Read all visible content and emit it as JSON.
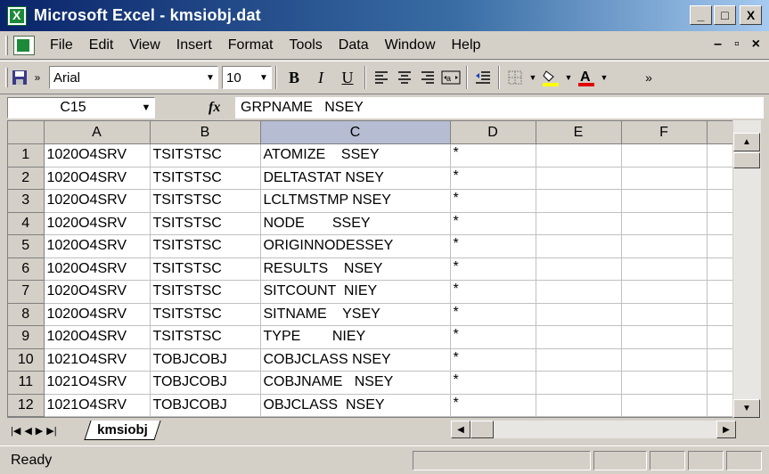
{
  "window": {
    "title": "Microsoft Excel - kmsiobj.dat",
    "minimize": "_",
    "maximize": "□",
    "close": "X"
  },
  "menu": {
    "items": [
      "File",
      "Edit",
      "View",
      "Insert",
      "Format",
      "Tools",
      "Data",
      "Window",
      "Help"
    ],
    "doc_min": "–",
    "doc_restore": "▫",
    "doc_close": "×"
  },
  "toolbar": {
    "font_name": "Arial",
    "font_size": "10",
    "bold": "B",
    "italic": "I",
    "underline": "U",
    "font_color": "#e00000",
    "fill_color": "#ffff00"
  },
  "formula_bar": {
    "name_box": "C15",
    "fx": "fx",
    "content": "GRPNAME   NSEY"
  },
  "grid": {
    "columns": [
      "A",
      "B",
      "C",
      "D",
      "E",
      "F"
    ],
    "selected_column": "C",
    "rows": [
      {
        "n": "1",
        "a": "1020O4SRV",
        "b": "TSITSTSC",
        "c": "ATOMIZE    SSEY",
        "d": "*"
      },
      {
        "n": "2",
        "a": "1020O4SRV",
        "b": "TSITSTSC",
        "c": "DELTASTAT NSEY",
        "d": "*"
      },
      {
        "n": "3",
        "a": "1020O4SRV",
        "b": "TSITSTSC",
        "c": "LCLTMSTMP NSEY",
        "d": "*"
      },
      {
        "n": "4",
        "a": "1020O4SRV",
        "b": "TSITSTSC",
        "c": "NODE       SSEY",
        "d": "*"
      },
      {
        "n": "5",
        "a": "1020O4SRV",
        "b": "TSITSTSC",
        "c": "ORIGINNODESSEY",
        "d": "*"
      },
      {
        "n": "6",
        "a": "1020O4SRV",
        "b": "TSITSTSC",
        "c": "RESULTS    NSEY",
        "d": "*"
      },
      {
        "n": "7",
        "a": "1020O4SRV",
        "b": "TSITSTSC",
        "c": "SITCOUNT  NIEY",
        "d": "*"
      },
      {
        "n": "8",
        "a": "1020O4SRV",
        "b": "TSITSTSC",
        "c": "SITNAME    YSEY",
        "d": "*"
      },
      {
        "n": "9",
        "a": "1020O4SRV",
        "b": "TSITSTSC",
        "c": "TYPE        NIEY",
        "d": "*"
      },
      {
        "n": "10",
        "a": "1021O4SRV",
        "b": "TOBJCOBJ",
        "c": "COBJCLASS NSEY",
        "d": "*"
      },
      {
        "n": "11",
        "a": "1021O4SRV",
        "b": "TOBJCOBJ",
        "c": "COBJNAME   NSEY",
        "d": "*"
      },
      {
        "n": "12",
        "a": "1021O4SRV",
        "b": "TOBJCOBJ",
        "c": "OBJCLASS  NSEY",
        "d": "*"
      }
    ]
  },
  "sheet_tabs": {
    "active": "kmsiobj"
  },
  "status": {
    "text": "Ready"
  }
}
